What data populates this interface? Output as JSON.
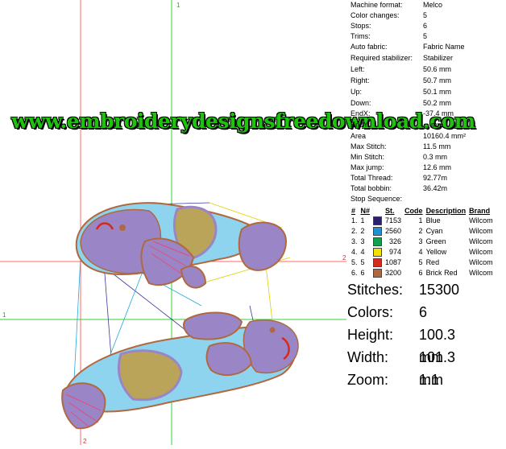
{
  "design_info": {
    "rows": [
      {
        "key": "Machine format:",
        "value": "Melco"
      },
      {
        "key": "Color changes:",
        "value": "5"
      },
      {
        "key": "Stops:",
        "value": "6"
      },
      {
        "key": "Trims:",
        "value": "5"
      },
      {
        "key": "Auto fabric:",
        "value": "Fabric Name"
      },
      {
        "key": "Required stabilizer:",
        "value": "Stabilizer"
      },
      {
        "key": "Left:",
        "value": "50.6 mm"
      },
      {
        "key": "Right:",
        "value": "50.7 mm"
      },
      {
        "key": "Up:",
        "value": "50.1 mm"
      },
      {
        "key": "Down:",
        "value": "50.2 mm"
      },
      {
        "key": "EndX:",
        "value": "-37.4 mm"
      },
      {
        "key": "EndY:",
        "value": "... mm"
      },
      {
        "key": "Area",
        "value": "10160.4 mm²"
      },
      {
        "key": "Max Stitch:",
        "value": "11.5 mm"
      },
      {
        "key": "Min Stitch:",
        "value": "0.3 mm"
      },
      {
        "key": "Max jump:",
        "value": "12.6 mm"
      },
      {
        "key": "Total Thread:",
        "value": "92.77m"
      },
      {
        "key": "Total bobbin:",
        "value": "36.42m"
      },
      {
        "key": "Stop Sequence:",
        "value": ""
      }
    ]
  },
  "stop_table": {
    "headers": {
      "idx": "#",
      "n": "N#",
      "st": "St.",
      "code": "Code",
      "desc": "Description",
      "brand": "Brand"
    },
    "rows": [
      {
        "idx": "1.",
        "n": "1",
        "color": "#2b1f6e",
        "st": "7153",
        "code": "1",
        "desc": "Blue",
        "brand": "Wilcom"
      },
      {
        "idx": "2.",
        "n": "2",
        "color": "#1f8fd6",
        "st": "2560",
        "code": "2",
        "desc": "Cyan",
        "brand": "Wilcom"
      },
      {
        "idx": "3.",
        "n": "3",
        "color": "#11a050",
        "st": "326",
        "code": "3",
        "desc": "Green",
        "brand": "Wilcom"
      },
      {
        "idx": "4.",
        "n": "4",
        "color": "#f2e200",
        "st": "974",
        "code": "4",
        "desc": "Yellow",
        "brand": "Wilcom"
      },
      {
        "idx": "5.",
        "n": "5",
        "color": "#d42a1e",
        "st": "1087",
        "code": "5",
        "desc": "Red",
        "brand": "Wilcom"
      },
      {
        "idx": "6.",
        "n": "6",
        "color": "#b0683f",
        "st": "3200",
        "code": "6",
        "desc": "Brick Red",
        "brand": "Wilcom"
      }
    ]
  },
  "summary": {
    "stitches_label": "Stitches:",
    "stitches": "15300",
    "colors_label": "Colors:",
    "colors": "6",
    "height_label": "Height:",
    "height": "100.3 mm",
    "width_label": "Width:",
    "width": "101.3 mm",
    "zoom_label": "Zoom:",
    "zoom": "1:1"
  },
  "canvas": {
    "axis_label_top": "1",
    "axis_label_left": "1",
    "axis_label_right": "2",
    "axis_label_bottom": "2"
  },
  "watermark": "www.embroiderydesignsfreedownload.com"
}
